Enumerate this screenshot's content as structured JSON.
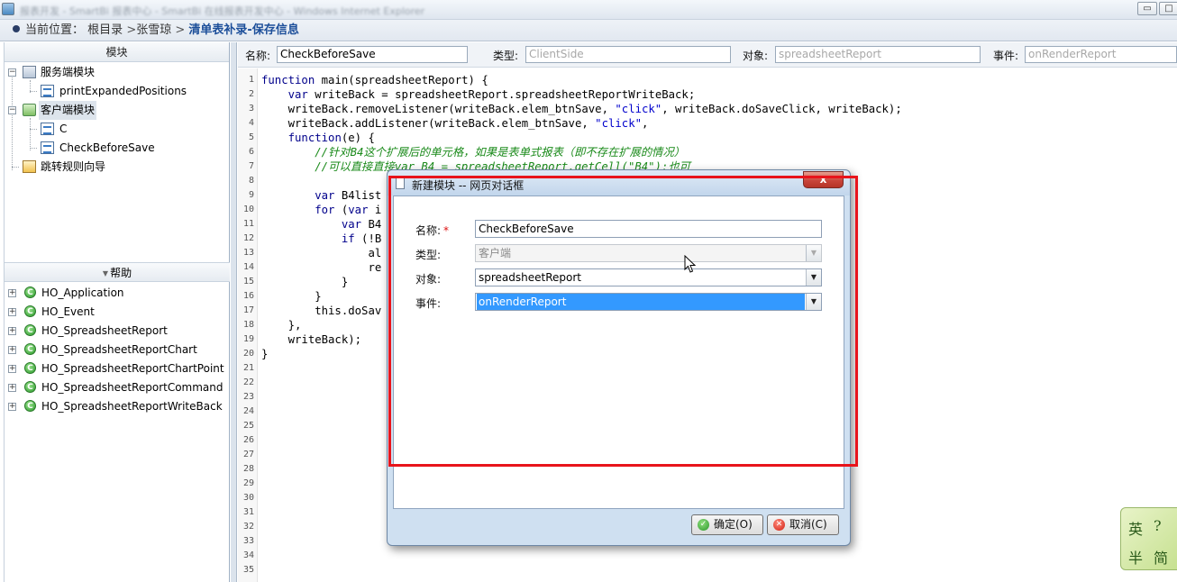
{
  "window": {
    "title_blurred": "报表开发 - SmartBi 报表中心 - SmartBi 在线报表开发中心 - Windows Internet Explorer",
    "minimize": "▭",
    "restore": "□"
  },
  "breadcrumb": {
    "prefix": "当前位置：",
    "items": [
      "根目录",
      "张雪琼"
    ],
    "separator": ">",
    "current": "清单表补录-保存信息"
  },
  "left_panel": {
    "modules_header": "模块",
    "tree": [
      {
        "label": "服务端模块",
        "icon": "server-module-icon"
      },
      {
        "label": "printExpandedPositions",
        "icon": "script-doc-icon"
      },
      {
        "label": "客户端模块",
        "icon": "client-module-icon"
      },
      {
        "label": "C",
        "icon": "script-doc-icon"
      },
      {
        "label": "CheckBeforeSave",
        "icon": "script-doc-icon"
      },
      {
        "label": "跳转规则向导",
        "icon": "wizard-icon"
      }
    ],
    "help_header": "帮助",
    "help_items": [
      "HO_Application",
      "HO_Event",
      "HO_SpreadsheetReport",
      "HO_SpreadsheetReportChart",
      "HO_SpreadsheetReportChartPoint",
      "HO_SpreadsheetReportCommand",
      "HO_SpreadsheetReportWriteBack"
    ]
  },
  "props": {
    "name_label": "名称:",
    "name_value": "CheckBeforeSave",
    "type_label": "类型:",
    "type_value": "ClientSide",
    "object_label": "对象:",
    "object_value": "spreadsheetReport",
    "event_label": "事件:",
    "event_value": "onRenderReport"
  },
  "editor": {
    "line_count": 35,
    "lines": [
      "function main(spreadsheetReport) {",
      "    var writeBack = spreadsheetReport.spreadsheetReportWriteBack;",
      "    writeBack.removeListener(writeBack.elem_btnSave, \"click\", writeBack.doSaveClick, writeBack);",
      "    writeBack.addListener(writeBack.elem_btnSave, \"click\",",
      "    function(e) {",
      "        //针对B4这个扩展后的单元格，如果是表单式报表（即不存在扩展的情况）",
      "        //可以直接直接var B4 = spreadsheetReport.getCell(\"B4\");也可",
      "",
      "        var B4list",
      "        for (var i",
      "            var B4",
      "            if (!B",
      "                al",
      "                re",
      "            }",
      "        }",
      "        this.doSav",
      "    },",
      "    writeBack);",
      "}"
    ]
  },
  "dialog": {
    "title": "新建模块 -- 网页对话框",
    "close": "x",
    "name_label": "名称:",
    "required_mark": "*",
    "name_value": "CheckBeforeSave",
    "type_label": "类型:",
    "type_value": "客户端",
    "object_label": "对象:",
    "object_value": "spreadsheetReport",
    "event_label": "事件:",
    "event_value": "onRenderReport",
    "ok_label": "确定(O)",
    "cancel_label": "取消(C)"
  },
  "ime": {
    "chars": [
      "英",
      "?",
      "半",
      "简"
    ]
  },
  "colors": {
    "highlight": "#e8141b",
    "breadcrumb_current": "#1d4f9a",
    "selection": "#3399ff",
    "comment": "#1a8a1a",
    "keyword": "#00008b",
    "string": "#0000cc"
  }
}
